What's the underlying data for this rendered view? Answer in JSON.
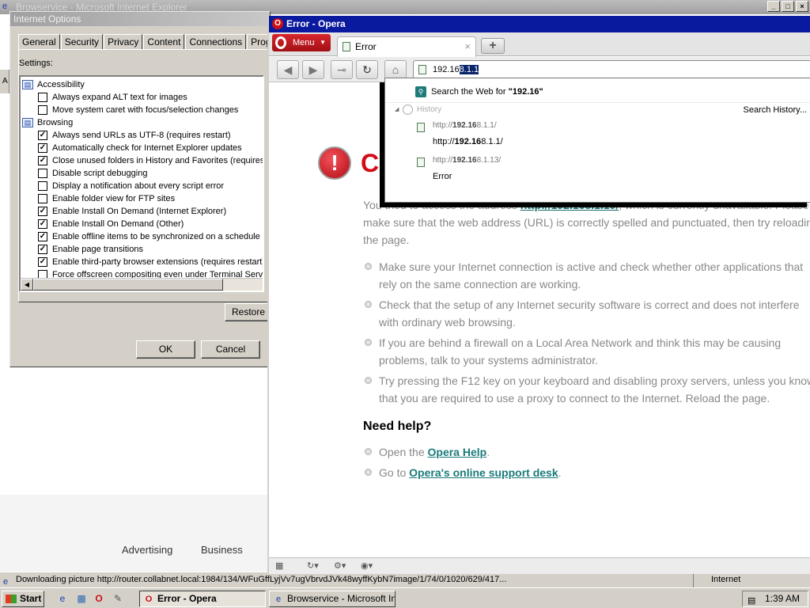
{
  "ie": {
    "title": "Browservice - Microsoft Internet Explorer",
    "status_text": "Downloading picture http://router.collabnet.local:1984/134/WFuGffLyjVv7ugVbrvdJVk48wyffKybN7image/1/74/0/1020/629/417...",
    "status_zone": "Internet",
    "footer_links": [
      "Advertising",
      "Business"
    ],
    "toolbar_letter": "A"
  },
  "internet_options": {
    "title": "Internet Options",
    "tabs": [
      "General",
      "Security",
      "Privacy",
      "Content",
      "Connections",
      "Programs"
    ],
    "settings_label": "Settings:",
    "items": [
      {
        "type": "category",
        "label": "Accessibility"
      },
      {
        "type": "check",
        "label": "Always expand ALT text for images",
        "checked": false
      },
      {
        "type": "check",
        "label": "Move system caret with focus/selection changes",
        "checked": false
      },
      {
        "type": "category",
        "label": "Browsing"
      },
      {
        "type": "check",
        "label": "Always send URLs as UTF-8 (requires restart)",
        "checked": true
      },
      {
        "type": "check",
        "label": "Automatically check for Internet Explorer updates",
        "checked": true
      },
      {
        "type": "check",
        "label": "Close unused folders in History and Favorites (requires r",
        "checked": true
      },
      {
        "type": "check",
        "label": "Disable script debugging",
        "checked": false
      },
      {
        "type": "check",
        "label": "Display a notification about every script error",
        "checked": false
      },
      {
        "type": "check",
        "label": "Enable folder view for FTP sites",
        "checked": false
      },
      {
        "type": "check",
        "label": "Enable Install On Demand (Internet Explorer)",
        "checked": true
      },
      {
        "type": "check",
        "label": "Enable Install On Demand (Other)",
        "checked": true
      },
      {
        "type": "check",
        "label": "Enable offline items to be synchronized on a schedule",
        "checked": true
      },
      {
        "type": "check",
        "label": "Enable page transitions",
        "checked": true
      },
      {
        "type": "check",
        "label": "Enable third-party browser extensions (requires restart)",
        "checked": true
      },
      {
        "type": "check",
        "label": "Force offscreen compositing even under Terminal Serv",
        "checked": false
      }
    ],
    "restore_label": "Restore",
    "ok_label": "OK",
    "cancel_label": "Cancel"
  },
  "opera": {
    "title": "Error - Opera",
    "menu_label": "Menu",
    "tab_label": "Error",
    "address_plain": "192.16",
    "address_selected": "8.1.1",
    "dropdown": {
      "search_prefix": "Search the Web for ",
      "search_term": "\"192.16\"",
      "history_label": "History",
      "search_history_label": "Search History...",
      "items": [
        {
          "url_pre": "http://",
          "url_bold": "192.16",
          "url_post": "8.1.1/",
          "title_pre": "http://",
          "title_bold": "192.16",
          "title_post": "8.1.1/"
        },
        {
          "url_pre": "http://",
          "url_bold": "192.16",
          "url_post": "8.1.13/",
          "title_pre": "",
          "title_bold": "",
          "title_post": "Error"
        }
      ]
    },
    "error": {
      "title": "Co",
      "body_pre": "You tried to access the address ",
      "body_link": "http://192.168.1.10/",
      "body_post": ", which is currently unavailable. Please make sure that the web address (URL) is correctly spelled and punctuated, then try reloading the page.",
      "tips": [
        "Make sure your Internet connection is active and check whether other applications that rely on the same connection are working.",
        "Check that the setup of any Internet security software is correct and does not interfere with ordinary web browsing.",
        "If you are behind a firewall on a Local Area Network and think this may be causing problems, talk to your systems administrator.",
        "Try pressing the F12 key on your keyboard and disabling proxy servers, unless you know that you are required to use a proxy to connect to the Internet. Reload the page."
      ],
      "help_title": "Need help?",
      "help_items": [
        {
          "pre": "Open the ",
          "link": "Opera Help",
          "post": "."
        },
        {
          "pre": "Go to ",
          "link": "Opera's online support desk",
          "post": "."
        }
      ]
    }
  },
  "taskbar": {
    "start_label": "Start",
    "tasks": [
      "Error - Opera",
      "Browservice - Microsoft Int..."
    ],
    "clock": "1:39 AM"
  }
}
